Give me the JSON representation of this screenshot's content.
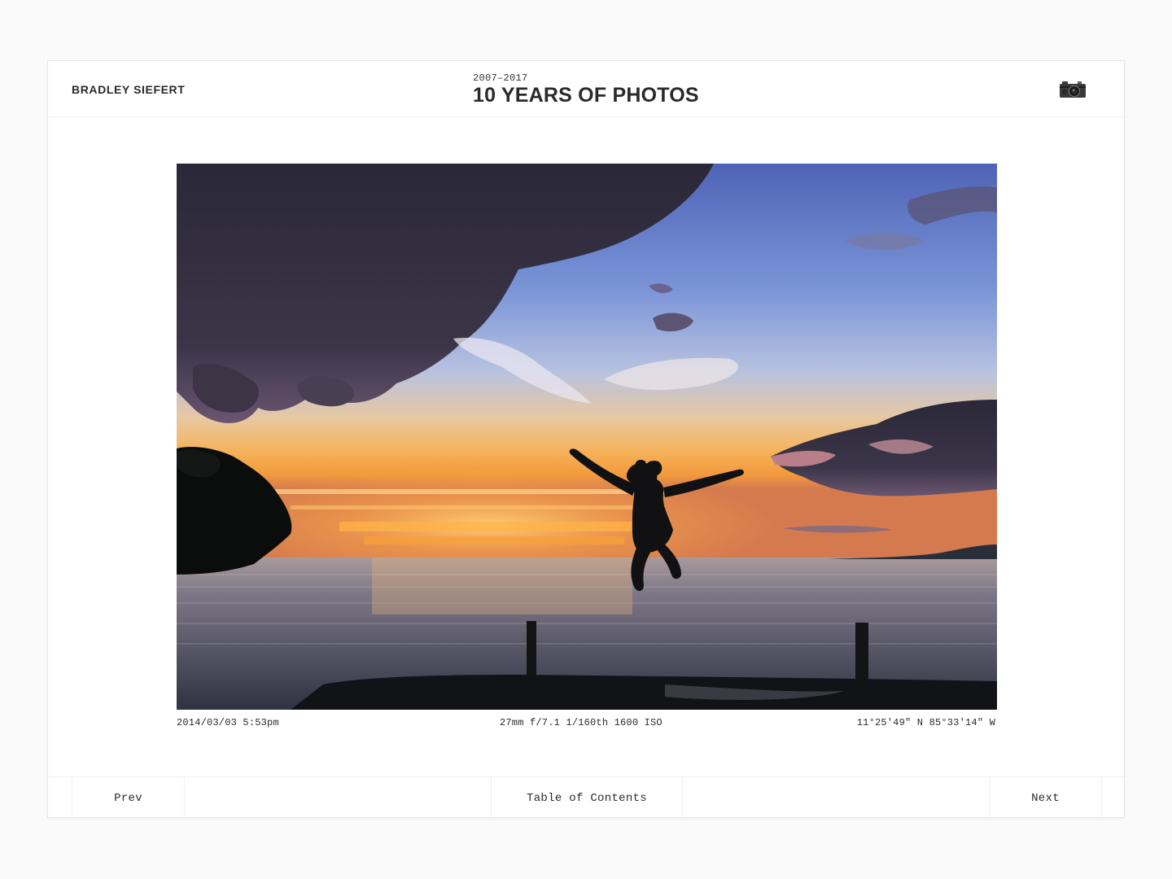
{
  "header": {
    "author": "BRADLEY SIEFERT",
    "years": "2007–2017",
    "title": "10 YEARS OF PHOTOS",
    "camera_icon": "camera-icon"
  },
  "photo": {
    "date": "2014/03/03 5:53pm",
    "exif": "27mm f/7.1 1/160th 1600 ISO",
    "location": "11°25′49″ N 85°33′14″ W"
  },
  "footer": {
    "prev": "Prev",
    "toc": "Table of Contents",
    "next": "Next"
  },
  "colors": {
    "background": "#fafafa",
    "card": "#ffffff",
    "text": "#2a2a2a"
  }
}
